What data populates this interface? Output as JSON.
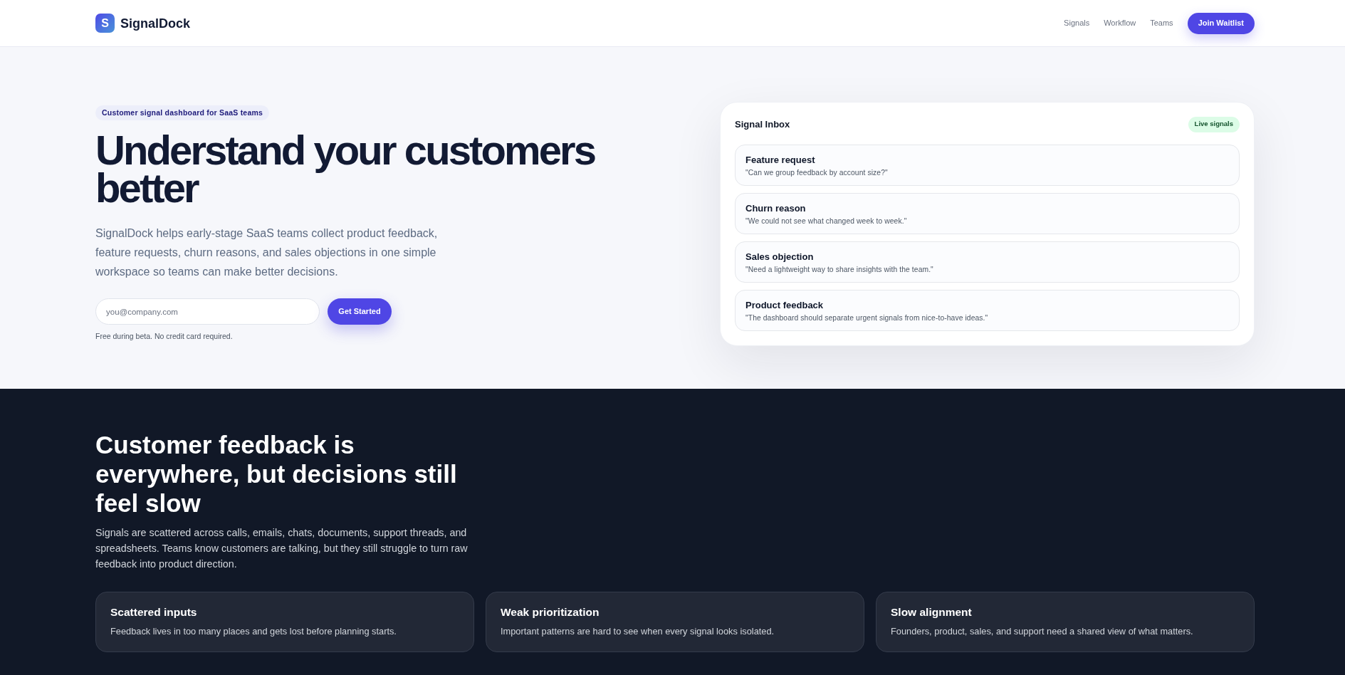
{
  "header": {
    "logo_mark": "S",
    "brand": "SignalDock",
    "nav_links": [
      "Signals",
      "Workflow",
      "Teams"
    ],
    "cta": "Join Waitlist"
  },
  "hero": {
    "badge": "Customer signal dashboard for SaaS teams",
    "headline": "Understand your customers better",
    "description": "SignalDock helps early-stage SaaS teams collect product feedback, feature requests, churn reasons, and sales objections in one simple workspace so teams can make better decisions.",
    "email_field": {
      "placeholder": "you@company.com"
    },
    "submit": "Get Started",
    "note": "Free during beta. No credit card required."
  },
  "inbox": {
    "title": "Signal Inbox",
    "status_badge": "Live signals",
    "signals": [
      {
        "type": "Feature request",
        "quote": "\"Can we group feedback by account size?\""
      },
      {
        "type": "Churn reason",
        "quote": "\"We could not see what changed week to week.\""
      },
      {
        "type": "Sales objection",
        "quote": "\"Need a lightweight way to share insights with the team.\""
      },
      {
        "type": "Product feedback",
        "quote": "\"The dashboard should separate urgent signals from nice-to-have ideas.\""
      }
    ]
  },
  "problem": {
    "headline": "Customer feedback is everywhere, but decisions still feel slow",
    "description": "Signals are scattered across calls, emails, chats, documents, support threads, and spreadsheets. Teams know customers are talking, but they still struggle to turn raw feedback into product direction.",
    "cards": [
      {
        "title": "Scattered inputs",
        "description": "Feedback lives in too many places and gets lost before planning starts."
      },
      {
        "title": "Weak prioritization",
        "description": "Important patterns are hard to see when every signal looks isolated."
      },
      {
        "title": "Slow alignment",
        "description": "Founders, product, sales, and support need a shared view of what matters."
      }
    ]
  }
}
